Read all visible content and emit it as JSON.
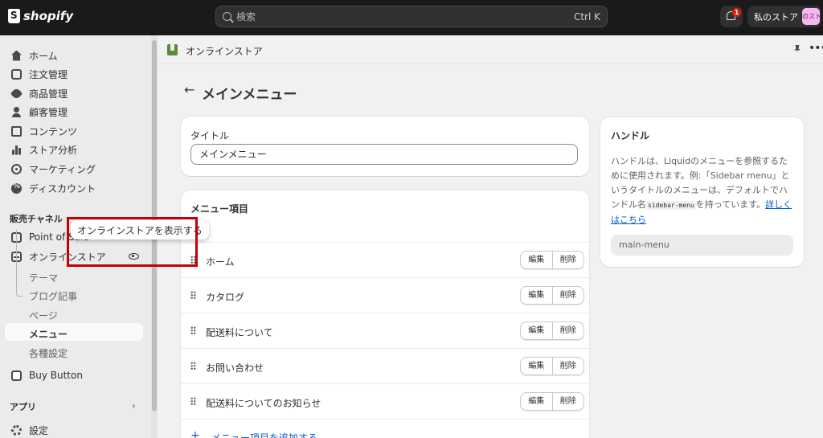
{
  "topbar": {
    "logo_text": "shopify",
    "search_placeholder": "検索",
    "search_shortcut": "Ctrl K",
    "notification_count": "1",
    "store_name": "私のストア",
    "store_avatar_text": "のスト"
  },
  "sidebar": {
    "items": [
      {
        "label": "ホーム",
        "icon": "home-icon"
      },
      {
        "label": "注文管理",
        "icon": "inbox-icon"
      },
      {
        "label": "商品管理",
        "icon": "tag-icon"
      },
      {
        "label": "顧客管理",
        "icon": "person-icon"
      },
      {
        "label": "コンテンツ",
        "icon": "content-icon"
      },
      {
        "label": "ストア分析",
        "icon": "chart-icon"
      },
      {
        "label": "マーケティング",
        "icon": "target-icon"
      },
      {
        "label": "ディスカウント",
        "icon": "discount-icon"
      }
    ],
    "sales_channel_heading": "販売チャネル",
    "pos_label": "Point of Sale",
    "online_store_label": "オンラインストア",
    "sub_items": [
      "テーマ",
      "ブログ記事",
      "ページ",
      "メニュー",
      "各種設定"
    ],
    "buy_button_label": "Buy Button",
    "apps_heading": "アプリ",
    "settings_label": "設定"
  },
  "tooltip": {
    "text": "オンラインストアを表示する"
  },
  "header": {
    "breadcrumb": "オンラインストア"
  },
  "page": {
    "title": "メインメニュー"
  },
  "title_card": {
    "label": "タイトル",
    "value": "メインメニュー"
  },
  "menu_card": {
    "heading": "メニュー項目",
    "rows": [
      {
        "label": "ホーム"
      },
      {
        "label": "カタログ"
      },
      {
        "label": "配送料について"
      },
      {
        "label": "お問い合わせ"
      },
      {
        "label": "配送料についてのお知らせ"
      }
    ],
    "edit_label": "編集",
    "delete_label": "削除",
    "add_label": "メニュー項目を追加する"
  },
  "handle_card": {
    "title": "ハンドル",
    "desc_part1": "ハンドルは、Liquidのメニューを参照するために使用されます。例:「Sidebar menu」というタイトルのメニューは、デフォルトでハンドル名",
    "desc_code": "sidebar-menu",
    "desc_part2": "を持っています。",
    "desc_link": "詳しくはこちら",
    "value": "main-menu"
  },
  "colors": {
    "topbar_bg": "#1a1a1a",
    "highlight_border": "#c40000",
    "link": "#005bd3"
  }
}
